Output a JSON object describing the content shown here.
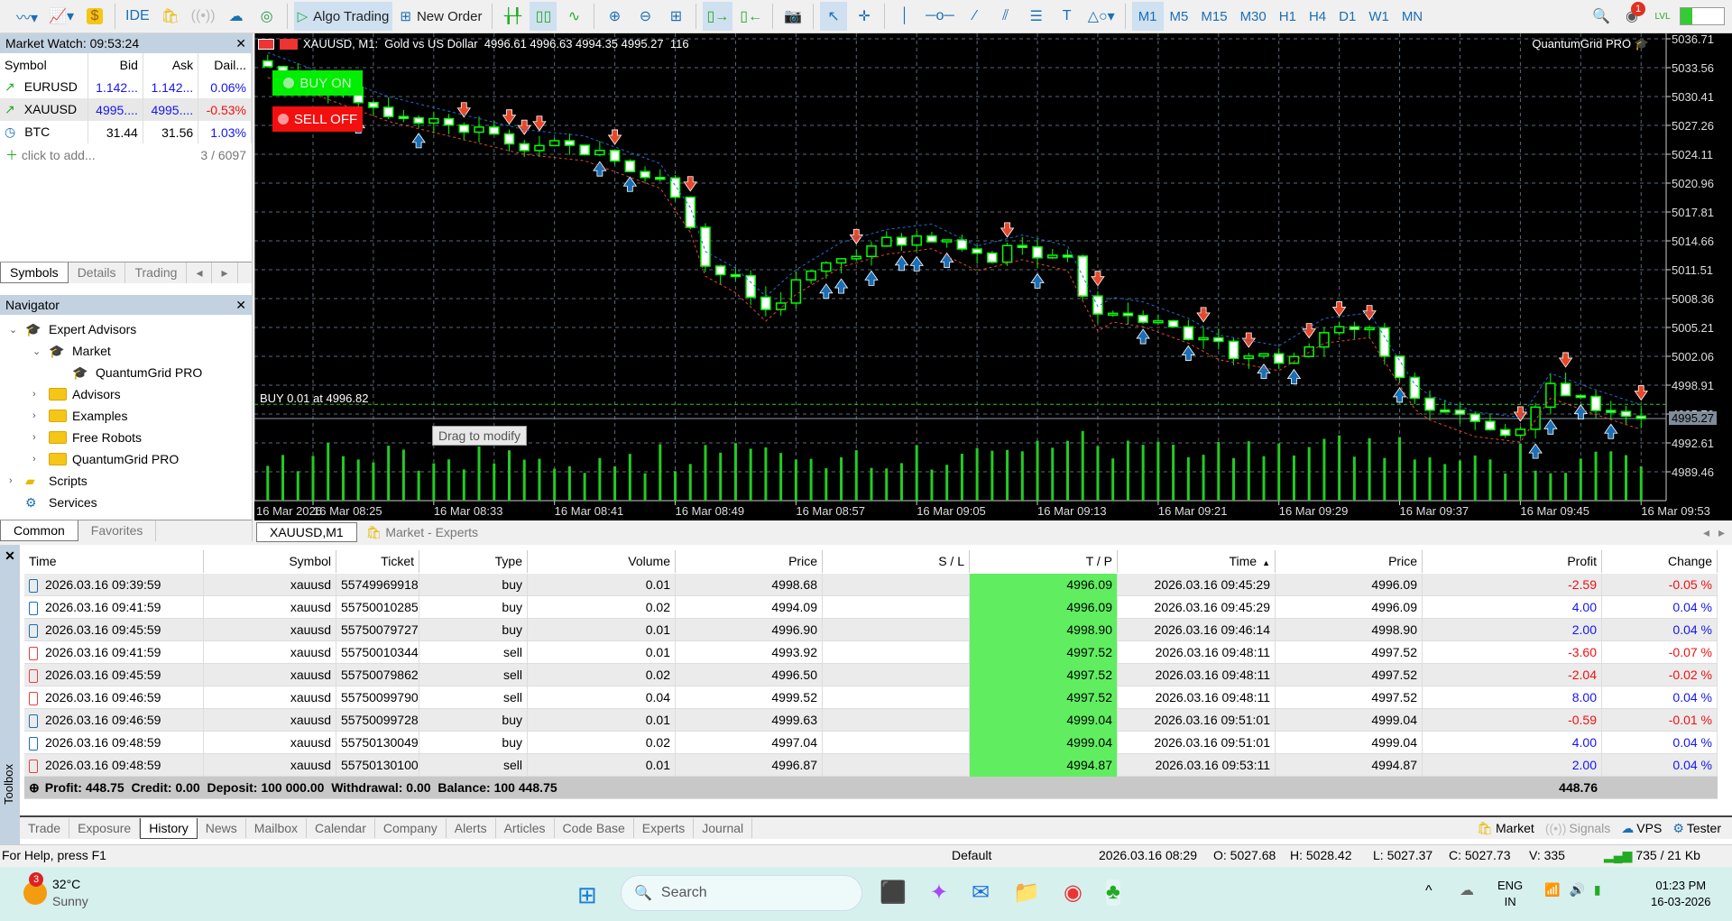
{
  "toolbar": {
    "ide": "IDE",
    "algo_trading": "Algo Trading",
    "new_order": "New Order",
    "timeframes": [
      "M1",
      "M5",
      "M15",
      "M30",
      "H1",
      "H4",
      "D1",
      "W1",
      "MN"
    ],
    "active_timeframe": "M1",
    "notification_count": "1",
    "level_label": "LVL"
  },
  "market_watch": {
    "title": "Market Watch: 09:53:24",
    "columns": [
      "Symbol",
      "Bid",
      "Ask",
      "Dail..."
    ],
    "rows": [
      {
        "symbol": "EURUSD",
        "bid": "1.142...",
        "ask": "1.142...",
        "daily": "0.06%",
        "dir": "up"
      },
      {
        "symbol": "XAUUSD",
        "bid": "4995....",
        "ask": "4995....",
        "daily": "-0.53%",
        "dir": "down"
      },
      {
        "symbol": "BTC",
        "bid": "31.44",
        "ask": "31.56",
        "daily": "1.03%",
        "dir": "flat"
      }
    ],
    "add_label": "click to add...",
    "count": "3 / 6097",
    "tabs": [
      "Symbols",
      "Details",
      "Trading"
    ]
  },
  "navigator": {
    "title": "Navigator",
    "items": [
      {
        "label": "Expert Advisors",
        "level": 0,
        "icon": "expert-icon",
        "exp": "open"
      },
      {
        "label": "Market",
        "level": 1,
        "icon": "expert-icon",
        "exp": "open"
      },
      {
        "label": "QuantumGrid PRO",
        "level": 2,
        "icon": "expert-icon",
        "exp": ""
      },
      {
        "label": "Advisors",
        "level": 1,
        "icon": "folder-icon",
        "exp": "closed"
      },
      {
        "label": "Examples",
        "level": 1,
        "icon": "folder-icon",
        "exp": "closed"
      },
      {
        "label": "Free Robots",
        "level": 1,
        "icon": "folder-icon",
        "exp": "closed"
      },
      {
        "label": "QuantumGrid PRO",
        "level": 1,
        "icon": "folder-icon",
        "exp": "closed"
      },
      {
        "label": "Scripts",
        "level": 0,
        "icon": "script-icon",
        "exp": "closed"
      },
      {
        "label": "Services",
        "level": 0,
        "icon": "service-icon",
        "exp": ""
      }
    ],
    "tabs": [
      "Common",
      "Favorites"
    ]
  },
  "chart": {
    "header": "XAUUSD, M1:  Gold vs US Dollar  4996.61 4996.63 4994.35 4995.27  116",
    "ea_name": "QuantumGrid PRO",
    "buy_button": "BUY ON",
    "sell_button": "SELL OFF",
    "position_label": "BUY 0.01 at 4996.82",
    "tooltip": "Drag to modify",
    "current_price": "4995.27",
    "tabs": [
      "XAUUSD,M1",
      "Market - Experts"
    ]
  },
  "chart_data": {
    "type": "candlestick",
    "symbol": "XAUUSD",
    "timeframe": "M1",
    "grid": true,
    "price_ticks": [
      "5036.71",
      "5033.56",
      "5030.41",
      "5027.26",
      "5024.11",
      "5020.96",
      "5017.81",
      "5014.66",
      "5011.51",
      "5008.36",
      "5005.21",
      "5002.06",
      "4998.91",
      "4995.76",
      "4992.61",
      "4989.46"
    ],
    "ylim": [
      4988.5,
      5037.5
    ],
    "time_ticks": [
      "16 Mar 2026",
      "16 Mar 08:25",
      "16 Mar 08:33",
      "16 Mar 08:41",
      "16 Mar 08:49",
      "16 Mar 08:57",
      "16 Mar 09:05",
      "16 Mar 09:13",
      "16 Mar 09:21",
      "16 Mar 09:29",
      "16 Mar 09:37",
      "16 Mar 09:45",
      "16 Mar 09:53"
    ],
    "close_path": [
      [
        "08:22",
        5033.7
      ],
      [
        "08:30",
        5028.9
      ],
      [
        "08:39",
        5025.3
      ],
      [
        "08:43",
        5024.6
      ],
      [
        "08:48",
        5021.6
      ],
      [
        "08:50",
        5016.8
      ],
      [
        "08:51",
        5012.0
      ],
      [
        "08:53",
        5010.2
      ],
      [
        "08:55",
        5007.1
      ],
      [
        "08:57",
        5010.0
      ],
      [
        "09:00",
        5013.0
      ],
      [
        "09:03",
        5014.4
      ],
      [
        "09:06",
        5015.0
      ],
      [
        "09:09",
        5012.6
      ],
      [
        "09:12",
        5013.8
      ],
      [
        "09:15",
        5012.6
      ],
      [
        "09:17",
        5006.0
      ],
      [
        "09:18",
        5007.0
      ],
      [
        "09:20",
        5006.5
      ],
      [
        "09:23",
        5004.7
      ],
      [
        "09:25",
        5002.9
      ],
      [
        "09:29",
        5001.7
      ],
      [
        "09:32",
        5004.7
      ],
      [
        "09:35",
        5005.3
      ],
      [
        "09:38",
        4997.5
      ],
      [
        "09:39",
        4996.3
      ],
      [
        "09:42",
        4994.5
      ],
      [
        "09:45",
        4993.9
      ],
      [
        "09:47",
        4998.7
      ],
      [
        "09:50",
        4996.9
      ],
      [
        "09:53",
        4995.27
      ]
    ],
    "position_price": 4996.82,
    "bid_line": 4995.27,
    "colors": {
      "up": "#00ff00",
      "down_fill": "#ffffff",
      "volume": "#22cc22",
      "buy_arrow": "#1a6fb5",
      "sell_arrow": "#e8482a"
    }
  },
  "history": {
    "columns": [
      "Time",
      "Symbol",
      "Ticket",
      "Type",
      "Volume",
      "Price",
      "S / L",
      "T / P",
      "Time",
      "Price",
      "Profit",
      "Change"
    ],
    "rows": [
      [
        "2026.03.16 09:39:59",
        "xauusd",
        "55749969918",
        "buy",
        "0.01",
        "4998.68",
        "",
        "4996.09",
        "2026.03.16 09:45:29",
        "4996.09",
        "-2.59",
        "-0.05 %"
      ],
      [
        "2026.03.16 09:41:59",
        "xauusd",
        "55750010285",
        "buy",
        "0.02",
        "4994.09",
        "",
        "4996.09",
        "2026.03.16 09:45:29",
        "4996.09",
        "4.00",
        "0.04 %"
      ],
      [
        "2026.03.16 09:45:59",
        "xauusd",
        "55750079727",
        "buy",
        "0.01",
        "4996.90",
        "",
        "4998.90",
        "2026.03.16 09:46:14",
        "4998.90",
        "2.00",
        "0.04 %"
      ],
      [
        "2026.03.16 09:41:59",
        "xauusd",
        "55750010344",
        "sell",
        "0.01",
        "4993.92",
        "",
        "4997.52",
        "2026.03.16 09:48:11",
        "4997.52",
        "-3.60",
        "-0.07 %"
      ],
      [
        "2026.03.16 09:45:59",
        "xauusd",
        "55750079862",
        "sell",
        "0.02",
        "4996.50",
        "",
        "4997.52",
        "2026.03.16 09:48:11",
        "4997.52",
        "-2.04",
        "-0.02 %"
      ],
      [
        "2026.03.16 09:46:59",
        "xauusd",
        "55750099790",
        "sell",
        "0.04",
        "4999.52",
        "",
        "4997.52",
        "2026.03.16 09:48:11",
        "4997.52",
        "8.00",
        "0.04 %"
      ],
      [
        "2026.03.16 09:46:59",
        "xauusd",
        "55750099728",
        "buy",
        "0.01",
        "4999.63",
        "",
        "4999.04",
        "2026.03.16 09:51:01",
        "4999.04",
        "-0.59",
        "-0.01 %"
      ],
      [
        "2026.03.16 09:48:59",
        "xauusd",
        "55750130049",
        "buy",
        "0.02",
        "4997.04",
        "",
        "4999.04",
        "2026.03.16 09:51:01",
        "4999.04",
        "4.00",
        "0.04 %"
      ],
      [
        "2026.03.16 09:48:59",
        "xauusd",
        "55750130100",
        "sell",
        "0.01",
        "4996.87",
        "",
        "4994.87",
        "2026.03.16 09:53:11",
        "4994.87",
        "2.00",
        "0.04 %"
      ]
    ],
    "summary": "Profit: 448.75  Credit: 0.00  Deposit: 100 000.00  Withdrawal: 0.00  Balance: 100 448.75",
    "summary_total": "448.76",
    "sort_column": "Time"
  },
  "toolbox": {
    "label": "Toolbox",
    "tabs": [
      "Trade",
      "Exposure",
      "History",
      "News",
      "Mailbox",
      "Calendar",
      "Company",
      "Alerts",
      "Articles",
      "Code Base",
      "Experts",
      "Journal"
    ],
    "active_tab": "History",
    "right": [
      "Market",
      "Signals",
      "VPS",
      "Tester"
    ]
  },
  "status": {
    "help": "For Help, press F1",
    "profile": "Default",
    "datetime": "2026.03.16 08:29",
    "open": "O: 5027.68",
    "high": "H: 5028.42",
    "low": "L: 5027.37",
    "close": "C: 5027.73",
    "volume": "V: 335",
    "traffic": "735 / 21 Kb"
  },
  "taskbar": {
    "weather_badge": "3",
    "temperature": "32°C",
    "weather": "Sunny",
    "search": "Search",
    "lang1": "ENG",
    "lang2": "IN",
    "time": "01:23 PM",
    "date": "16-03-2026"
  }
}
